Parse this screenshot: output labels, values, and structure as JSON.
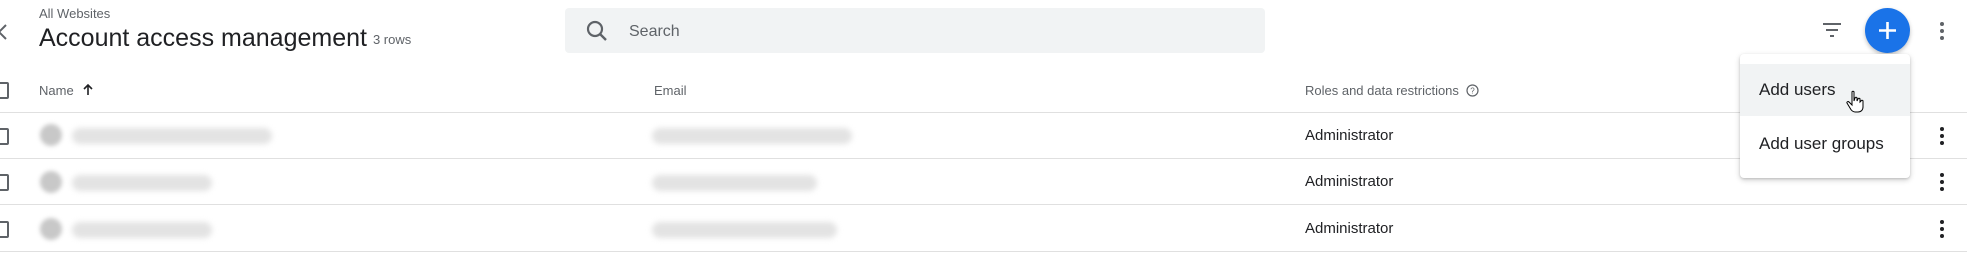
{
  "header": {
    "breadcrumb": "All Websites",
    "title": "Account access management",
    "row_count": "3 rows"
  },
  "search": {
    "placeholder": "Search",
    "value": ""
  },
  "toolbar": {
    "filter_icon": "filter-icon",
    "add_icon": "plus-icon",
    "more_icon": "more-vert-icon",
    "accent_color": "#1a73e8"
  },
  "table": {
    "columns": {
      "name": "Name",
      "email": "Email",
      "roles": "Roles and data restrictions"
    },
    "sort": "ascending",
    "rows": [
      {
        "role": "Administrator"
      },
      {
        "role": "Administrator"
      },
      {
        "role": "Administrator"
      }
    ]
  },
  "add_menu": {
    "items": [
      "Add users",
      "Add user groups"
    ]
  }
}
